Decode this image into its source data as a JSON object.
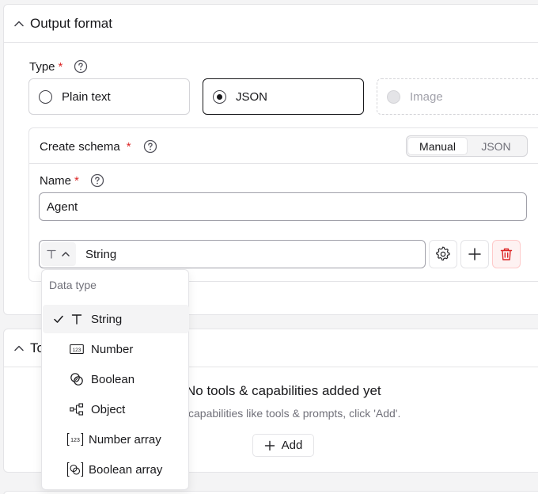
{
  "output_format": {
    "title": "Output format",
    "type_label": "Type",
    "required_mark": "*",
    "options": [
      {
        "label": "Plain text",
        "state": "unselected"
      },
      {
        "label": "JSON",
        "state": "selected"
      },
      {
        "label": "Image",
        "state": "disabled"
      }
    ]
  },
  "schema": {
    "title": "Create schema",
    "required_mark": "*",
    "modes": [
      "Manual",
      "JSON"
    ],
    "active_mode": "Manual",
    "name_label": "Name",
    "name_value": "Agent",
    "field": {
      "name": "String",
      "type_icon": "text-type-icon"
    }
  },
  "data_type_menu": {
    "title": "Data type",
    "selected": "String",
    "items": [
      {
        "label": "String",
        "icon": "text-type-icon"
      },
      {
        "label": "Number",
        "icon": "number-type-icon"
      },
      {
        "label": "Boolean",
        "icon": "boolean-type-icon"
      },
      {
        "label": "Object",
        "icon": "object-type-icon"
      },
      {
        "label": "Number array",
        "icon": "number-array-icon"
      },
      {
        "label": "Boolean array",
        "icon": "boolean-array-icon"
      }
    ]
  },
  "tools": {
    "title_visible": "To",
    "empty_title": "No tools & capabilities added yet",
    "empty_subtitle": "capabilities like tools & prompts, click 'Add'.",
    "add_label": "Add"
  },
  "colors": {
    "required": "#dc2626",
    "border": "#e4e4e7",
    "delete": "#dc2626",
    "delete_bg": "#fef2f2"
  }
}
